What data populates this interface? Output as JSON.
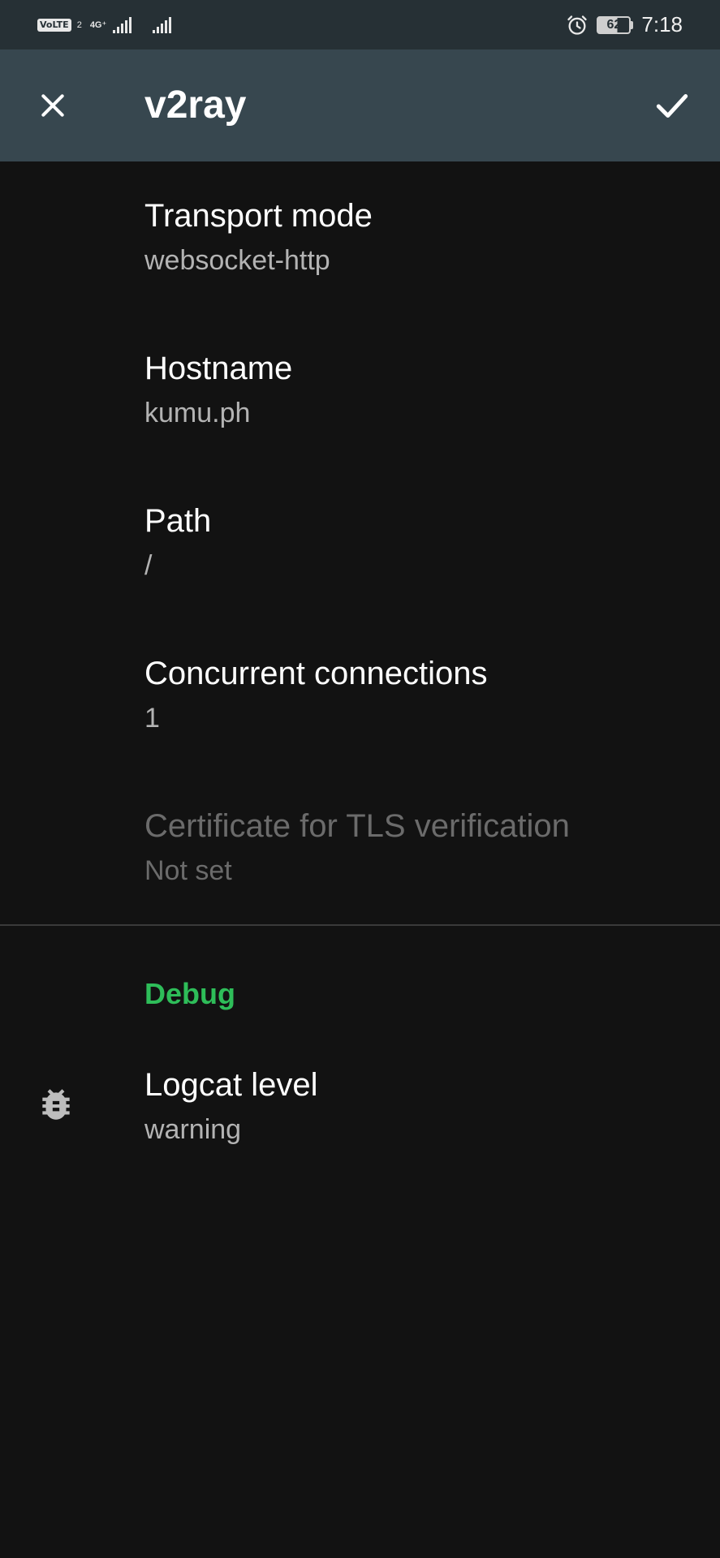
{
  "status_bar": {
    "volte": "VoLTE",
    "sim": "2",
    "network": "4G⁺",
    "battery": "62",
    "time": "7:18"
  },
  "toolbar": {
    "title": "v2ray",
    "close_icon": "close-icon",
    "save_icon": "check-icon"
  },
  "preferences": [
    {
      "title": "Transport mode",
      "summary": "websocket-http",
      "enabled": true
    },
    {
      "title": "Hostname",
      "summary": "kumu.ph",
      "enabled": true
    },
    {
      "title": "Path",
      "summary": "/",
      "enabled": true
    },
    {
      "title": "Concurrent connections",
      "summary": "1",
      "enabled": true
    },
    {
      "title": "Certificate for TLS verification",
      "summary": "Not set",
      "enabled": false
    }
  ],
  "debug": {
    "category": "Debug",
    "logcat": {
      "title": "Logcat level",
      "summary": "warning",
      "icon": "bug-icon"
    }
  },
  "colors": {
    "status_bar": "#263035",
    "toolbar": "#37474f",
    "background": "#121212",
    "accent": "#2ebd59"
  }
}
